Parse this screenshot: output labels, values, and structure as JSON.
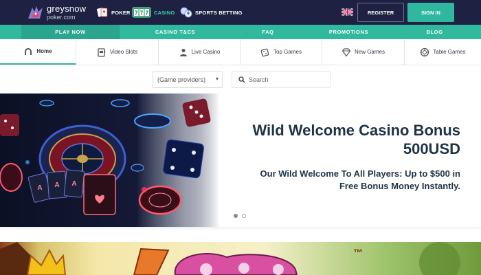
{
  "brand": {
    "name": "greysnow",
    "domain": "poker.com"
  },
  "products": [
    {
      "label": "POKER",
      "icon": "poker-cards-icon"
    },
    {
      "label": "CASINO",
      "icon": "slot-777-icon"
    },
    {
      "label": "SPORTS BETTING",
      "icon": "sports-balls-icon"
    }
  ],
  "header": {
    "register_label": "REGISTER",
    "signin_label": "SIGN IN",
    "language_icon": "uk-flag-icon"
  },
  "nav": [
    {
      "label": "PLAY NOW",
      "active": true
    },
    {
      "label": "CASINO T&CS",
      "active": false
    },
    {
      "label": "FAQ",
      "active": false
    },
    {
      "label": "PROMOTIONS",
      "active": false
    },
    {
      "label": "BLOG",
      "active": false
    }
  ],
  "categories": [
    {
      "label": "Home",
      "icon": "horseshoe-icon",
      "active": true
    },
    {
      "label": "Video Slots",
      "icon": "slot-machine-icon",
      "active": false
    },
    {
      "label": "Live Casino",
      "icon": "dealer-icon",
      "active": false
    },
    {
      "label": "Top Games",
      "icon": "dice-icon",
      "active": false
    },
    {
      "label": "New Games",
      "icon": "diamond-icon",
      "active": false
    },
    {
      "label": "Table Games",
      "icon": "chip-icon",
      "active": false
    }
  ],
  "filters": {
    "provider_selected": "(Game providers)",
    "search_placeholder": "Search"
  },
  "hero": {
    "title_line1": "Wild Welcome Casino Bonus",
    "title_line2": "500USD",
    "sub_line1": "Our Wild Welcome To All Players: Up to $500 in",
    "sub_line2": "Free Bonus Money Instantly.",
    "slides": 2,
    "active_slide": 1
  },
  "colors": {
    "topbar": "#1e2141",
    "accent": "#31b9a0",
    "text_dark": "#1f3344"
  }
}
